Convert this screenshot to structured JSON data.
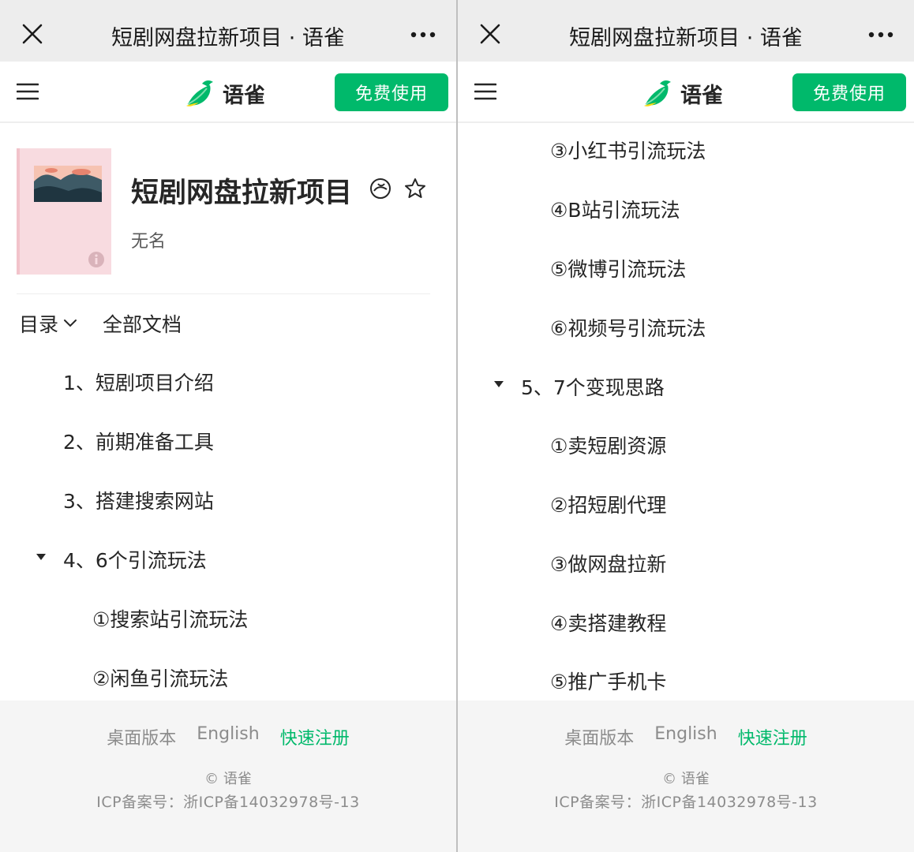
{
  "window": {
    "title": "短剧网盘拉新项目 · 语雀"
  },
  "app": {
    "brand_name": "语雀",
    "cta_label": "免费使用",
    "accent_color": "#00b96b"
  },
  "book": {
    "title": "短剧网盘拉新项目",
    "author": "无名"
  },
  "toc": {
    "label": "目录",
    "all_docs": "全部文档",
    "left_items": [
      "1、短剧项目介绍",
      "2、前期准备工具",
      "3、搭建搜索网站",
      "4、6个引流玩法",
      "①搜索站引流玩法",
      "②闲鱼引流玩法"
    ],
    "right_items": [
      "③小红书引流玩法",
      "④B站引流玩法",
      "⑤微博引流玩法",
      "⑥视频号引流玩法",
      "5、7个变现思路",
      "①卖短剧资源",
      "②招短剧代理",
      "③做网盘拉新",
      "④卖搭建教程",
      "⑤推广手机卡"
    ]
  },
  "footer": {
    "desktop": "桌面版本",
    "english": "English",
    "register": "快速注册",
    "copyright": "© 语雀",
    "icp": "ICP备案号：浙ICP备14032978号-13"
  },
  "icons": [
    "close-icon",
    "more-icon",
    "menu-icon",
    "yuque-logo-icon",
    "cover-info-icon",
    "knowledge-icon",
    "star-icon",
    "chevron-down-icon",
    "caret-down-icon"
  ]
}
